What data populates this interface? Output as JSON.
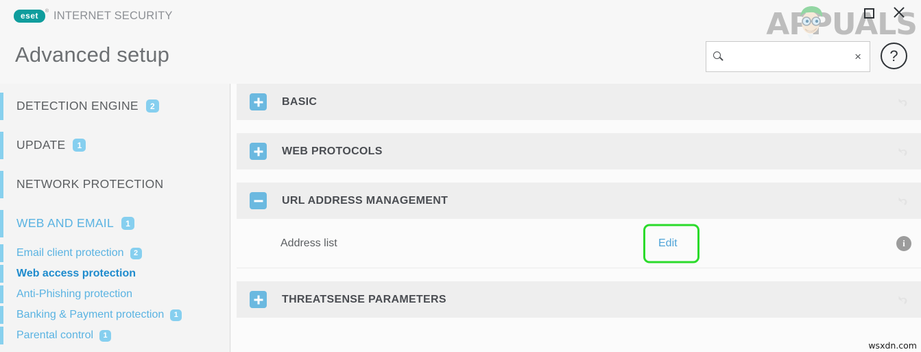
{
  "app": {
    "brand_mark": "eset",
    "brand_reg": "®",
    "suite_name": "INTERNET SECURITY",
    "page_title": "Advanced setup"
  },
  "window_controls": {
    "maximize_name": "maximize",
    "close_name": "close"
  },
  "search": {
    "value": "",
    "placeholder": "",
    "clear_label": "×",
    "icon": "search-icon"
  },
  "help": {
    "label": "?"
  },
  "sidebar": {
    "items": [
      {
        "label": "DETECTION ENGINE",
        "badge": "2",
        "level": "main",
        "state": "normal"
      },
      {
        "label": "UPDATE",
        "badge": "1",
        "level": "main",
        "state": "normal"
      },
      {
        "label": "NETWORK PROTECTION",
        "badge": "",
        "level": "main",
        "state": "normal"
      },
      {
        "label": "WEB AND EMAIL",
        "badge": "1",
        "level": "main",
        "state": "active-group"
      },
      {
        "label": "Email client protection",
        "badge": "2",
        "level": "sub",
        "state": "normal"
      },
      {
        "label": "Web access protection",
        "badge": "",
        "level": "sub",
        "state": "selected"
      },
      {
        "label": "Anti-Phishing protection",
        "badge": "",
        "level": "sub",
        "state": "normal"
      },
      {
        "label": "Banking & Payment protection",
        "badge": "1",
        "level": "sub",
        "state": "normal"
      },
      {
        "label": "Parental control",
        "badge": "1",
        "level": "sub",
        "state": "normal"
      }
    ]
  },
  "content": {
    "sections": [
      {
        "title": "BASIC",
        "expanded": false,
        "toggle_icon": "plus-icon"
      },
      {
        "title": "WEB PROTOCOLS",
        "expanded": false,
        "toggle_icon": "plus-icon"
      },
      {
        "title": "URL ADDRESS MANAGEMENT",
        "expanded": true,
        "toggle_icon": "minus-icon"
      },
      {
        "title": "THREATSENSE PARAMETERS",
        "expanded": false,
        "toggle_icon": "plus-icon"
      }
    ],
    "address_row": {
      "label": "Address list",
      "edit_label": "Edit",
      "info_label": "i"
    },
    "revert_icon": "revert-arrow-icon"
  },
  "watermarks": {
    "appuals": "APPUALS",
    "bottom": "wsxdn.com"
  },
  "colors": {
    "accent_blue": "#6bb9e0",
    "badge_blue": "#86cfef",
    "link_blue": "#4ea3d8",
    "selected_blue": "#1e8bcd",
    "highlight_green": "#2bdb2b",
    "eset_teal": "#0f9d9d"
  }
}
